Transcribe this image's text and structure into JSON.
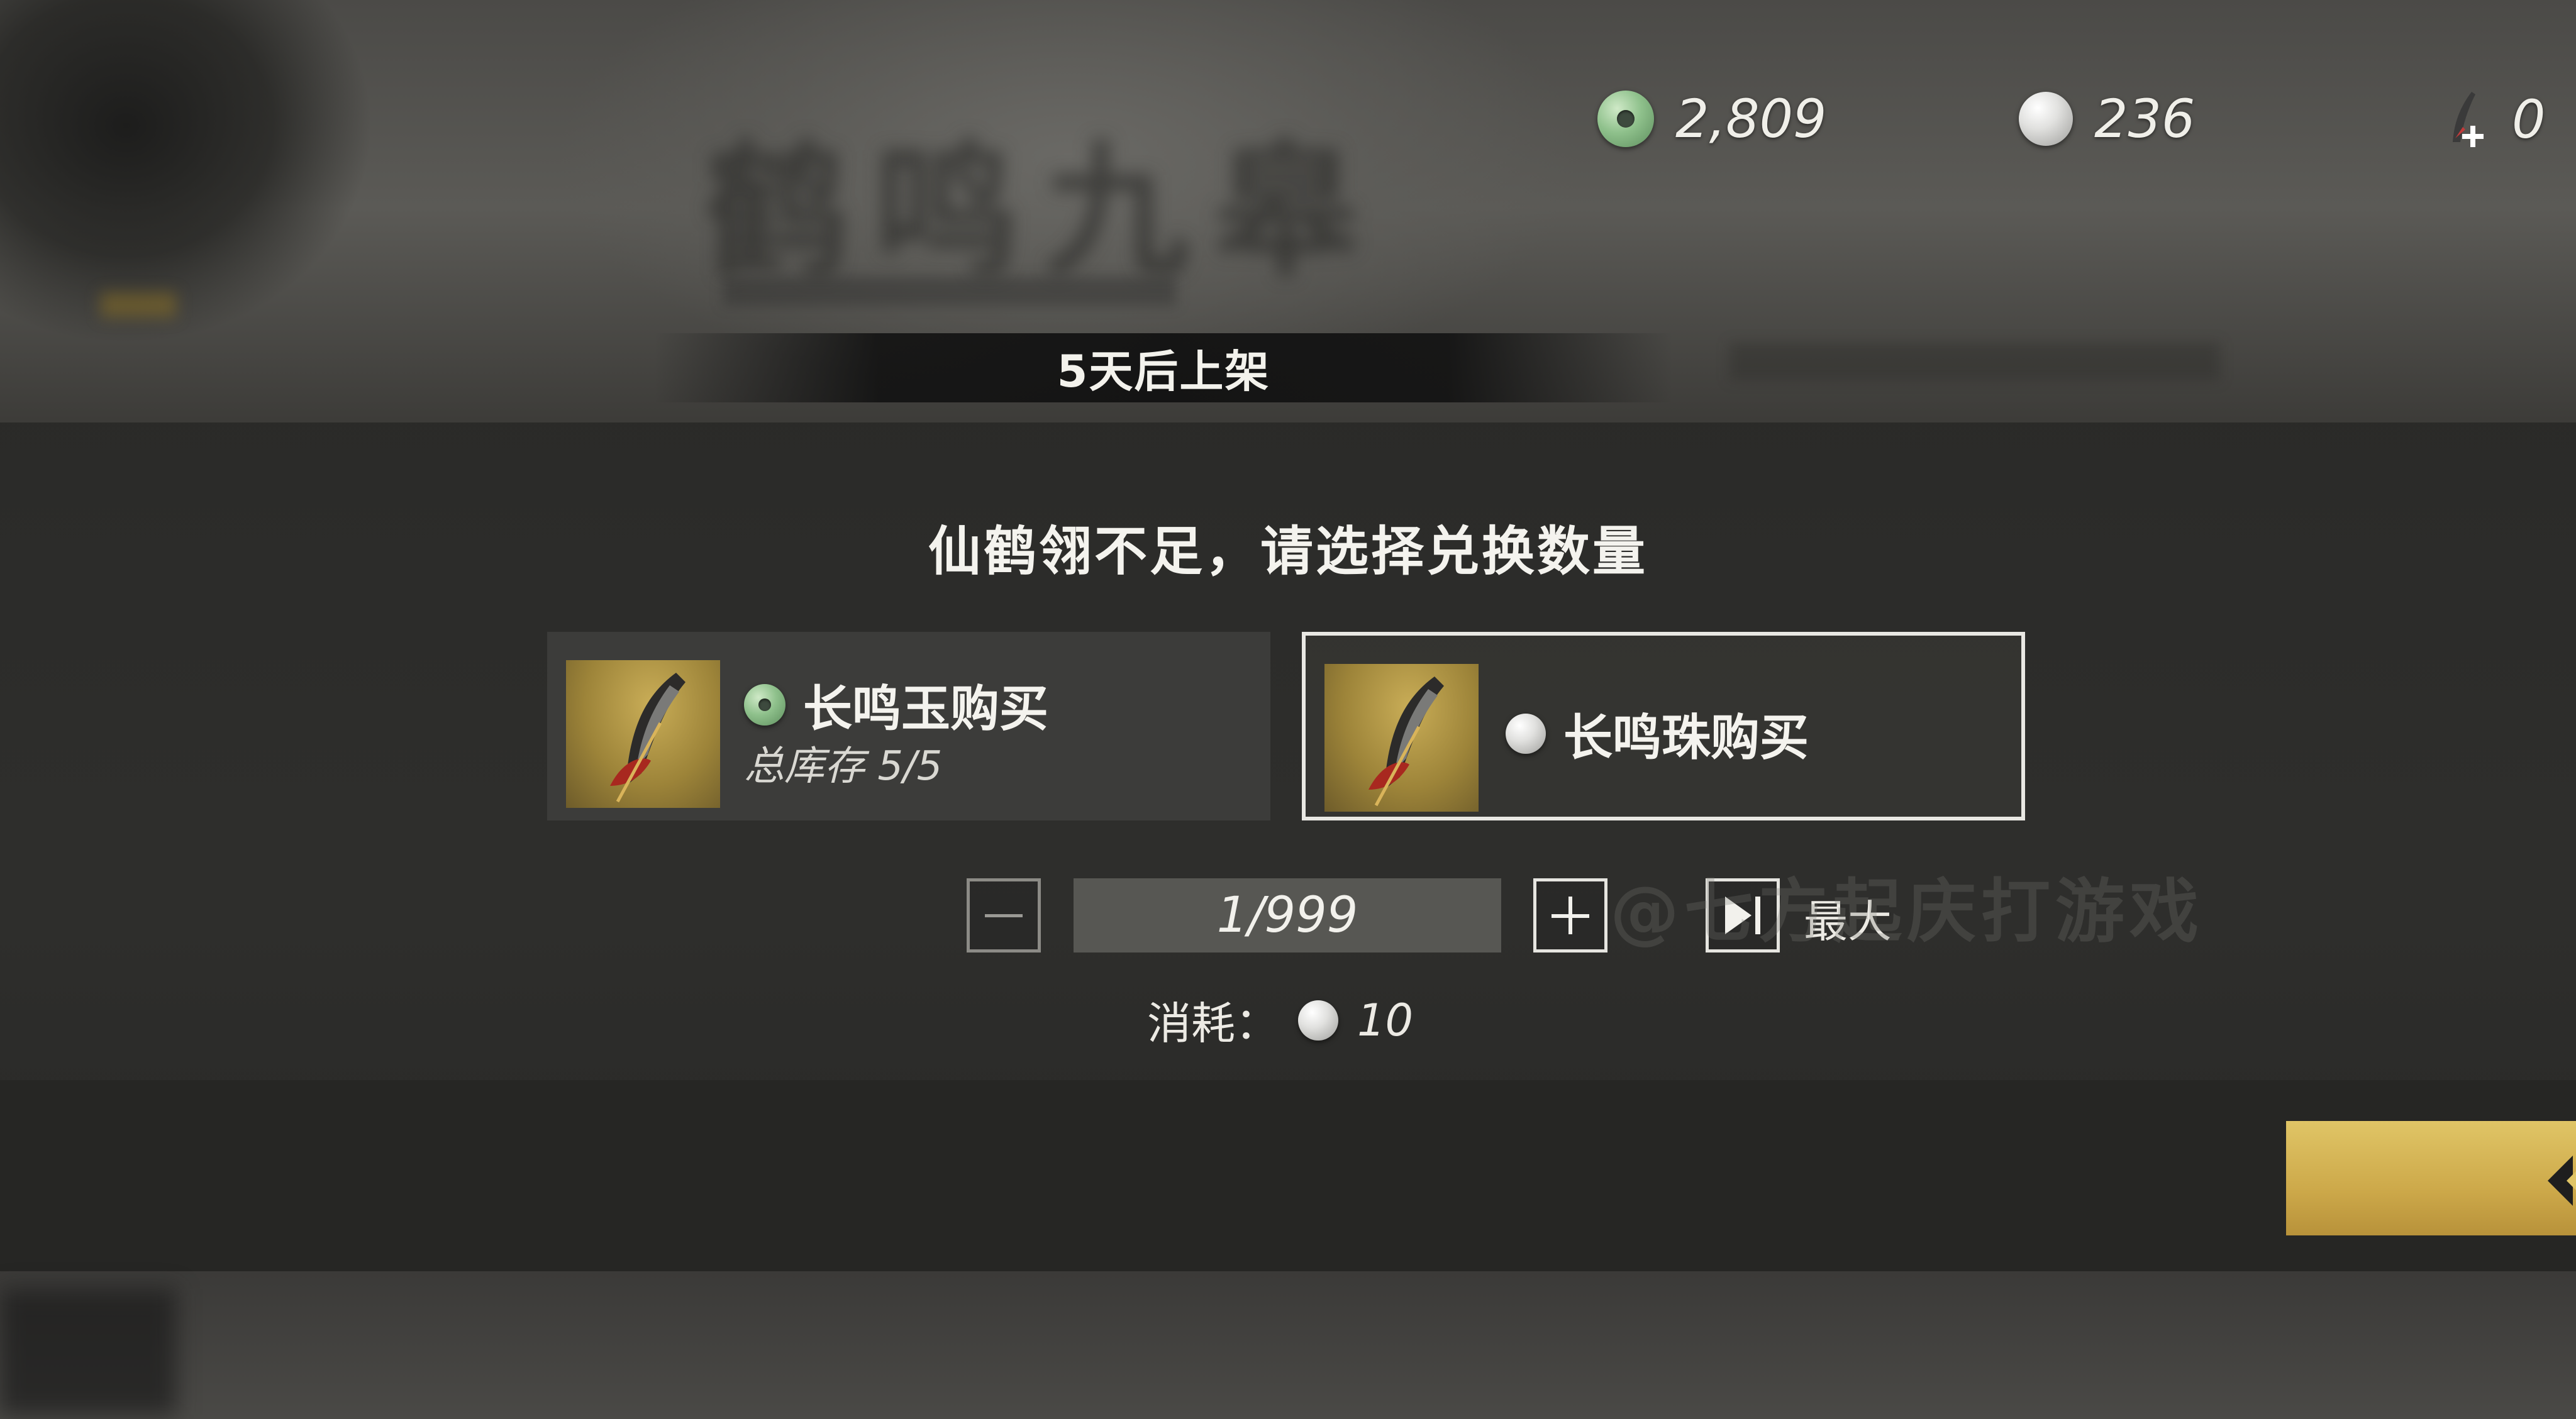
{
  "currencies": {
    "jade": {
      "icon": "jade-coin-icon",
      "amount": "2,809",
      "color": "#8fc18c"
    },
    "pearl": {
      "icon": "pearl-icon",
      "amount": "236",
      "color": "#e1e1df"
    },
    "feather": {
      "icon": "crane-feather-plus-icon",
      "amount": "0"
    }
  },
  "banner": {
    "text": "5天后上架"
  },
  "dialog": {
    "title": "仙鹤翎不足，请选择兑换数量",
    "options": [
      {
        "label": "长鸣玉购买",
        "currency_icon": "jade-coin-icon",
        "stock": "总库存 5/5",
        "selected": false
      },
      {
        "label": "长鸣珠购买",
        "currency_icon": "pearl-icon",
        "selected": true
      }
    ],
    "quantity": "1/999",
    "max_label": "最大",
    "cost": {
      "label": "消耗：",
      "icon": "pearl-icon",
      "value": "10"
    }
  },
  "colors": {
    "accent_gold": "#cda94a",
    "panel": "#2a2a28",
    "text": "#f4f3ee"
  }
}
